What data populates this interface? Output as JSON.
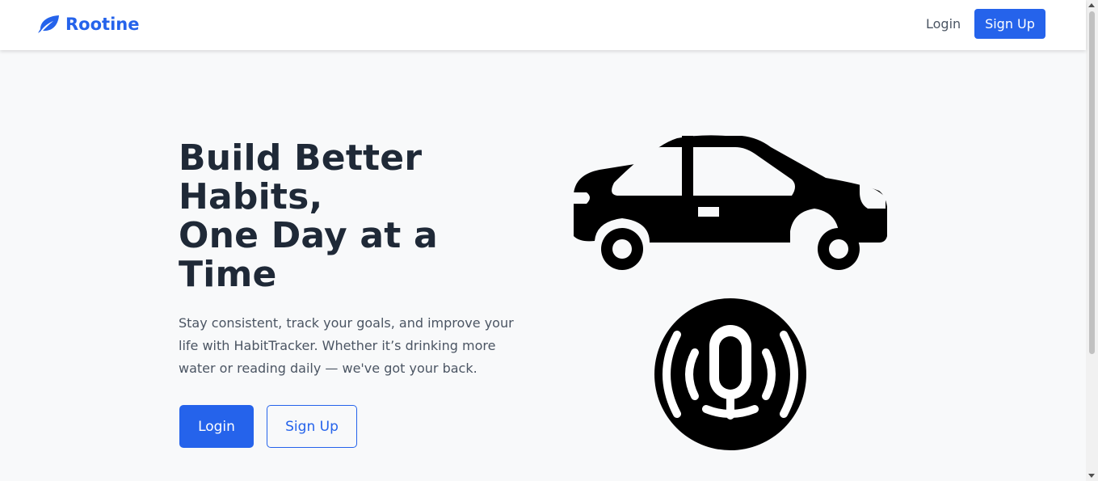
{
  "navbar": {
    "brand": "Rootine",
    "brand_icon": "leaf-icon",
    "login_label": "Login",
    "signup_label": "Sign Up"
  },
  "hero": {
    "title_lines": [
      "Build Better",
      "Habits,",
      "One Day at a",
      "Time"
    ],
    "description": "Stay consistent, track your goals, and improve your life with HabitTracker. Whether it’s drinking more water or reading daily — we've got your back.",
    "login_label": "Login",
    "signup_label": "Sign Up",
    "illustrations": [
      "car-icon",
      "podcast-icon"
    ]
  },
  "colors": {
    "accent": "#2563eb",
    "heading": "#1f2937",
    "text": "#4b5563",
    "background": "#f8f9fa"
  }
}
